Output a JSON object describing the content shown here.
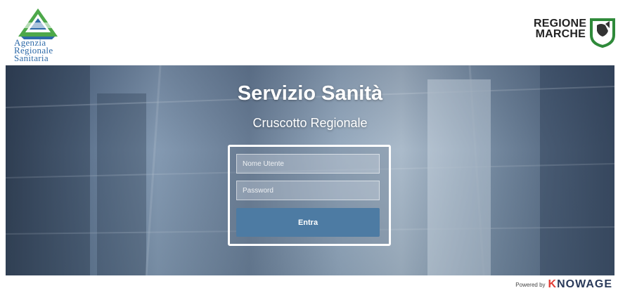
{
  "header": {
    "agency_logo": {
      "lines": [
        "Agenzia",
        "Regionale",
        "Sanitaria"
      ]
    },
    "region_logo": {
      "lines": [
        "REGIONE",
        "MARCHE"
      ]
    }
  },
  "hero": {
    "title": "Servizio Sanità",
    "subtitle": "Cruscotto Regionale"
  },
  "login": {
    "username_placeholder": "Nome Utente",
    "password_placeholder": "Password",
    "submit_label": "Entra",
    "button_color": "#4d7ba3"
  },
  "footer": {
    "powered_by": "Powered by",
    "brand_prefix": "K",
    "brand_rest": "NOWAGE"
  },
  "colors": {
    "agency_blue": "#2e6aa8",
    "agency_green": "#4da84a",
    "knowage_red": "#e23d36"
  }
}
